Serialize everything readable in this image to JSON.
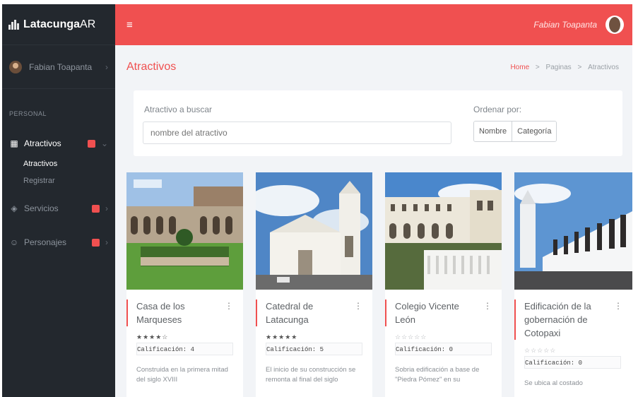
{
  "brand": {
    "name_bold": "Latacunga",
    "name_light": "AR"
  },
  "sidebar": {
    "user_name": "Fabian Toapanta",
    "section_label": "PERSONAL",
    "items": [
      {
        "label": "Atractivos",
        "icon": "gallery-icon",
        "badge": ""
      },
      {
        "label": "Servicios",
        "icon": "layers-icon",
        "badge": ""
      },
      {
        "label": "Personajes",
        "icon": "smile-icon",
        "badge": ""
      }
    ],
    "subitems": [
      {
        "label": "Atractivos"
      },
      {
        "label": "Registrar"
      }
    ]
  },
  "topbar": {
    "menu_icon": "hamburger-icon",
    "user_name": "Fabian Toapanta"
  },
  "page": {
    "title": "Atractivos"
  },
  "breadcrumb": {
    "home": "Home",
    "sep": ">",
    "pages": "Paginas",
    "current": "Atractivos"
  },
  "search": {
    "label": "Atractivo a buscar",
    "placeholder": "nombre del atractivo"
  },
  "sort": {
    "label": "Ordenar por:",
    "options": [
      "Nombre",
      "Categoría"
    ]
  },
  "cards": [
    {
      "title": "Casa de los Marqueses",
      "stars": "★★★★☆",
      "rating_text": "Calificación: 4",
      "description": "Construida en la primera mitad del siglo XVIII"
    },
    {
      "title": "Catedral de Latacunga",
      "stars": "★★★★★",
      "rating_text": "Calificación: 5",
      "description": "El inicio de su construcción se remonta al final del siglo"
    },
    {
      "title": "Colegio Vicente León",
      "stars": "☆☆☆☆☆",
      "rating_text": "Calificación: 0",
      "description": "Sobria edificación a base de \"Piedra Pómez\" en su"
    },
    {
      "title": "Edificación de la gobernación de Cotopaxi",
      "stars": "☆☆☆☆☆",
      "rating_text": "Calificación: 0",
      "description": "Se ubica al costado"
    }
  ],
  "colors": {
    "accent": "#f05050",
    "sidebar_bg": "#23282e",
    "content_bg": "#f2f4f7"
  }
}
